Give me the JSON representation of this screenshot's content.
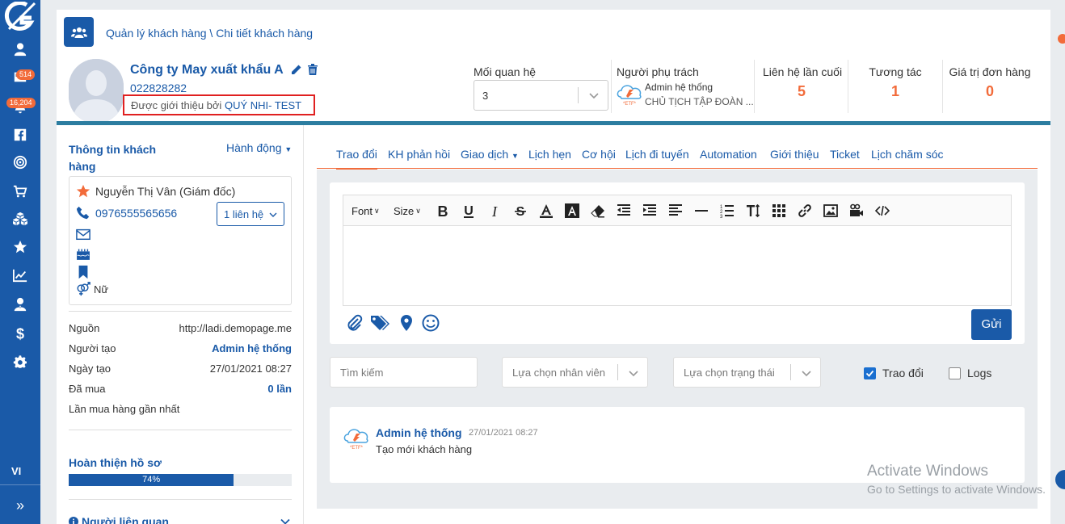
{
  "sidebar": {
    "badges": {
      "messages": "514",
      "notifications": "16,204"
    },
    "language": "VI"
  },
  "breadcrumb": "Quản lý khách hàng \\ Chi tiết khách hàng",
  "customer": {
    "name": "Công ty May xuất khẩu A",
    "phone": "022828282",
    "referral_prefix": "Được giới thiệu bởi",
    "referral_name": "QUÝ NHI- TEST"
  },
  "relationship": {
    "label": "Mối quan hệ",
    "value": "3"
  },
  "owner": {
    "label": "Người phụ trách",
    "name": "Admin hệ thống",
    "title": "CHỦ TỊCH TẬP ĐOÀN ..."
  },
  "stats": [
    {
      "label": "Liên hệ lần cuối",
      "value": "5"
    },
    {
      "label": "Tương tác",
      "value": "1"
    },
    {
      "label": "Giá trị đơn hàng",
      "value": "0"
    }
  ],
  "info": {
    "title": "Thông tin khách hàng",
    "actions_label": "Hành động",
    "contact_name": "Nguyễn Thị Vân (Giám đốc)",
    "contact_phone": "0976555565656",
    "contacts_button": "1 liên hệ",
    "gender": "Nữ",
    "fields": [
      {
        "key": "Nguồn",
        "value": "http://ladi.demopage.me"
      },
      {
        "key": "Người tạo",
        "value": "Admin hệ thống"
      },
      {
        "key": "Ngày tạo",
        "value": "27/01/2021 08:27"
      },
      {
        "key": "Đã mua",
        "value": "0 lần"
      },
      {
        "key": "Lần mua hàng gần nhất",
        "value": ""
      }
    ],
    "profile_label": "Hoàn thiện hồ sơ",
    "profile_percent_text": "74%",
    "profile_percent": 74,
    "related_label": "Người liên quan"
  },
  "tabs": [
    "Trao đổi",
    "KH phản hồi",
    "Giao dịch",
    "Lịch hẹn",
    "Cơ hội",
    "Lịch đi tuyến",
    "Automation",
    "Giới thiệu",
    "Ticket",
    "Lịch chăm sóc"
  ],
  "editor": {
    "font_label": "Font",
    "size_label": "Size",
    "send_label": "Gửi"
  },
  "filters": {
    "search_placeholder": "Tìm kiếm",
    "staff_placeholder": "Lựa chọn nhân viên",
    "status_placeholder": "Lựa chọn trạng thái",
    "check_exchange": "Trao đổi",
    "check_logs": "Logs"
  },
  "log": {
    "author": "Admin hệ thống",
    "time": "27/01/2021 08:27",
    "text": "Tạo mới khách hàng"
  },
  "watermark": {
    "line1": "Activate Windows",
    "line2": "Go to Settings to activate Windows."
  },
  "colors": {
    "primary": "#1a5aa8",
    "accent": "#f26b3a",
    "highlight": "#e02020"
  }
}
